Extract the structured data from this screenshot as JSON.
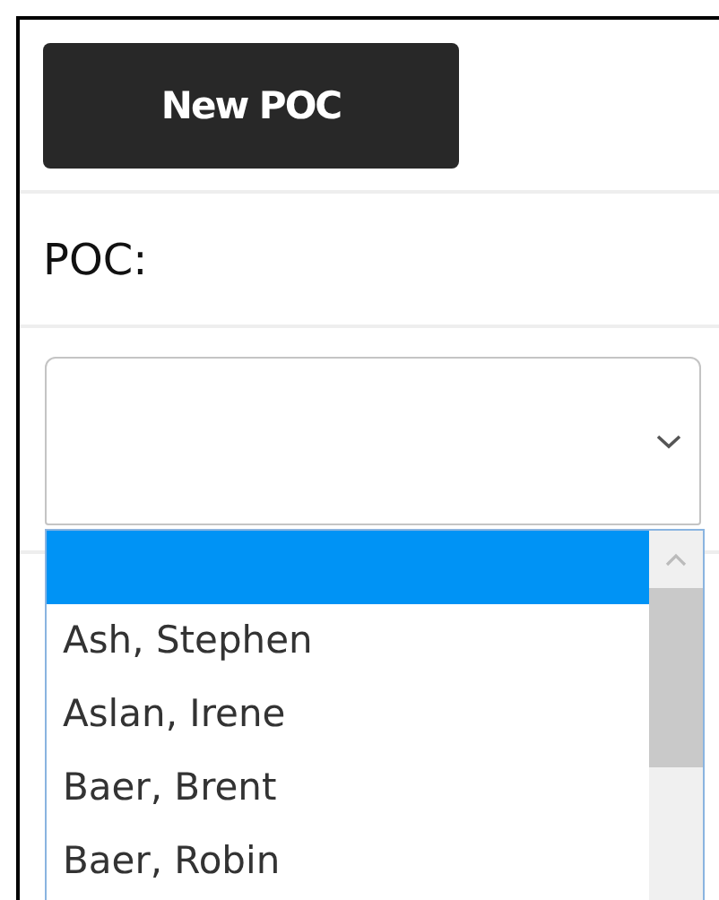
{
  "new_button": {
    "label": "New POC"
  },
  "poc_label": "POC:",
  "poc_select": {
    "expanded": true,
    "options": [
      {
        "selected": true
      },
      {
        "label": "Ash, Stephen",
        "selected": false
      },
      {
        "label": "Aslan, Irene",
        "selected": false
      },
      {
        "label": "Baer, Brent",
        "selected": false
      },
      {
        "label": "Baer, Robin",
        "selected": false
      }
    ]
  }
}
